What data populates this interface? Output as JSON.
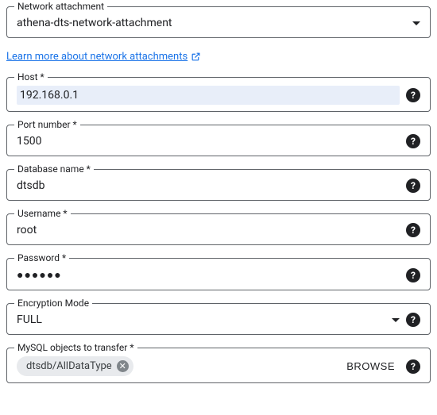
{
  "networkAttachment": {
    "label": "Network attachment",
    "value": "athena-dts-network-attachment"
  },
  "learnMoreLink": "Learn more about network attachments",
  "host": {
    "label": "Host *",
    "value": "192.168.0.1"
  },
  "port": {
    "label": "Port number *",
    "value": "1500"
  },
  "database": {
    "label": "Database name *",
    "value": "dtsdb"
  },
  "username": {
    "label": "Username *",
    "value": "root"
  },
  "password": {
    "label": "Password *",
    "value": "●●●●●●"
  },
  "encryption": {
    "label": "Encryption Mode",
    "value": "FULL"
  },
  "objects": {
    "label": "MySQL objects to transfer *",
    "chip": "dtsdb/AllDataType",
    "browse": "BROWSE"
  }
}
